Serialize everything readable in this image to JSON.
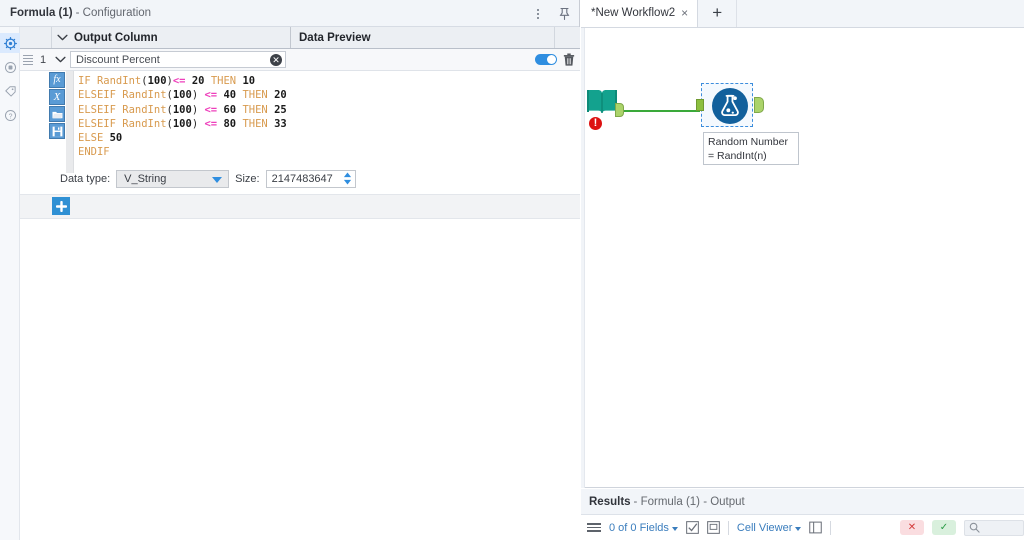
{
  "config_panel": {
    "title_strong": "Formula (1)",
    "title_light": "- Configuration",
    "columns": {
      "output_column": "Output Column",
      "data_preview": "Data Preview"
    },
    "row": {
      "number": "1",
      "output_column_value": "Discount Percent",
      "output_column_placeholder": "Output Column",
      "toggle_on": true
    },
    "expression": {
      "lines": [
        [
          {
            "t": "IF ",
            "c": "kw"
          },
          {
            "t": "RandInt",
            "c": "fn"
          },
          {
            "t": "(",
            "c": "plain"
          },
          {
            "t": "100",
            "c": "num"
          },
          {
            "t": ")",
            "c": "plain"
          },
          {
            "t": "<=",
            "c": "op"
          },
          {
            "t": " ",
            "c": "plain"
          },
          {
            "t": "20",
            "c": "num"
          },
          {
            "t": " ",
            "c": "plain"
          },
          {
            "t": "THEN",
            "c": "kw"
          },
          {
            "t": " ",
            "c": "plain"
          },
          {
            "t": "10",
            "c": "num"
          }
        ],
        [
          {
            "t": "ELSEIF ",
            "c": "kw"
          },
          {
            "t": "RandInt",
            "c": "fn"
          },
          {
            "t": "(",
            "c": "plain"
          },
          {
            "t": "100",
            "c": "num"
          },
          {
            "t": ") ",
            "c": "plain"
          },
          {
            "t": "<=",
            "c": "op"
          },
          {
            "t": " ",
            "c": "plain"
          },
          {
            "t": "40",
            "c": "num"
          },
          {
            "t": " ",
            "c": "plain"
          },
          {
            "t": "THEN",
            "c": "kw"
          },
          {
            "t": " ",
            "c": "plain"
          },
          {
            "t": "20",
            "c": "num"
          }
        ],
        [
          {
            "t": "ELSEIF ",
            "c": "kw"
          },
          {
            "t": "RandInt",
            "c": "fn"
          },
          {
            "t": "(",
            "c": "plain"
          },
          {
            "t": "100",
            "c": "num"
          },
          {
            "t": ") ",
            "c": "plain"
          },
          {
            "t": "<=",
            "c": "op"
          },
          {
            "t": " ",
            "c": "plain"
          },
          {
            "t": "60",
            "c": "num"
          },
          {
            "t": " ",
            "c": "plain"
          },
          {
            "t": "THEN",
            "c": "kw"
          },
          {
            "t": " ",
            "c": "plain"
          },
          {
            "t": "25",
            "c": "num"
          }
        ],
        [
          {
            "t": "ELSEIF ",
            "c": "kw"
          },
          {
            "t": "RandInt",
            "c": "fn"
          },
          {
            "t": "(",
            "c": "plain"
          },
          {
            "t": "100",
            "c": "num"
          },
          {
            "t": ") ",
            "c": "plain"
          },
          {
            "t": "<=",
            "c": "op"
          },
          {
            "t": " ",
            "c": "plain"
          },
          {
            "t": "80",
            "c": "num"
          },
          {
            "t": " ",
            "c": "plain"
          },
          {
            "t": "THEN",
            "c": "kw"
          },
          {
            "t": " ",
            "c": "plain"
          },
          {
            "t": "33",
            "c": "num"
          }
        ],
        [
          {
            "t": "ELSE ",
            "c": "kw"
          },
          {
            "t": "50",
            "c": "num"
          }
        ],
        [
          {
            "t": "ENDIF",
            "c": "kw"
          }
        ]
      ],
      "plain_text": "IF RandInt(100)<= 20 THEN 10\nELSEIF RandInt(100) <= 40 THEN 20\nELSEIF RandInt(100) <= 60 THEN 25\nELSEIF RandInt(100) <= 80 THEN 33\nELSE 50\nENDIF",
      "tools": [
        "fx",
        "X",
        "folder-open-icon",
        "save-icon"
      ]
    },
    "data_type": {
      "label": "Data type:",
      "value": "V_String",
      "size_label": "Size:",
      "size_value": "2147483647"
    },
    "add_button_label": "+",
    "rail_icons": [
      "gear-icon",
      "annotation-icon",
      "tag-icon",
      "help-icon"
    ],
    "header_actions": [
      "more-options-icon",
      "pin-icon"
    ]
  },
  "workflow": {
    "tab_label": "*New Workflow2",
    "tab_close_label": "×",
    "add_tab_label": "+",
    "nodes": [
      {
        "id": "input-data",
        "icon": "input-data-book-icon",
        "status": "error",
        "status_glyph": "!"
      },
      {
        "id": "formula",
        "icon": "flask-icon",
        "selected": true,
        "label_line1": "Random Number",
        "label_line2": "= RandInt(n)"
      }
    ],
    "connection_color": "#3aa93a"
  },
  "results_panel": {
    "title_strong": "Results",
    "title_light": "- Formula (1) - Output",
    "toolbar": {
      "fields_label": "0 of 0 Fields",
      "cell_viewer_label": "Cell Viewer",
      "error_count": "✕",
      "ok_count": "✓"
    }
  },
  "colors": {
    "accent_blue": "#2f8ee0",
    "node_blue": "#12609c",
    "connector_green": "#3aa93a",
    "error_red": "#dd1111",
    "keyword_orange": "#d89a4e",
    "operator_magenta": "#ee3fbb"
  }
}
